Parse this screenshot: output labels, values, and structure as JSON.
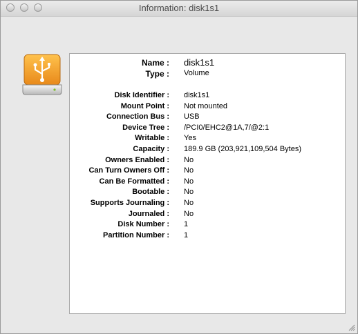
{
  "window": {
    "title": "Information: disk1s1"
  },
  "header": [
    {
      "label": "Name :",
      "value": "disk1s1"
    },
    {
      "label": "Type :",
      "value": "Volume"
    }
  ],
  "details": [
    {
      "label": "Disk Identifier :",
      "value": "disk1s1"
    },
    {
      "label": "Mount Point :",
      "value": "Not mounted"
    },
    {
      "label": "Connection Bus :",
      "value": "USB"
    },
    {
      "label": "Device Tree :",
      "value": "/PCI0/EHC2@1A,7/@2:1"
    },
    {
      "label": "Writable :",
      "value": "Yes"
    },
    {
      "label": "Capacity :",
      "value": "189.9 GB (203,921,109,504 Bytes)"
    },
    {
      "label": "Owners Enabled :",
      "value": "No"
    },
    {
      "label": "Can Turn Owners Off :",
      "value": "No"
    },
    {
      "label": "Can Be Formatted :",
      "value": "No"
    },
    {
      "label": "Bootable :",
      "value": "No"
    },
    {
      "label": "Supports Journaling :",
      "value": "No"
    },
    {
      "label": "Journaled :",
      "value": "No"
    },
    {
      "label": "Disk Number :",
      "value": "1"
    },
    {
      "label": "Partition Number :",
      "value": "1"
    }
  ],
  "icons": {
    "drive": "usb-drive-icon",
    "resize": "resize-grip-icon"
  },
  "colors": {
    "drive_orange": "#f2a23a",
    "panel_bg": "#ffffff",
    "window_bg": "#e8e8e8"
  }
}
